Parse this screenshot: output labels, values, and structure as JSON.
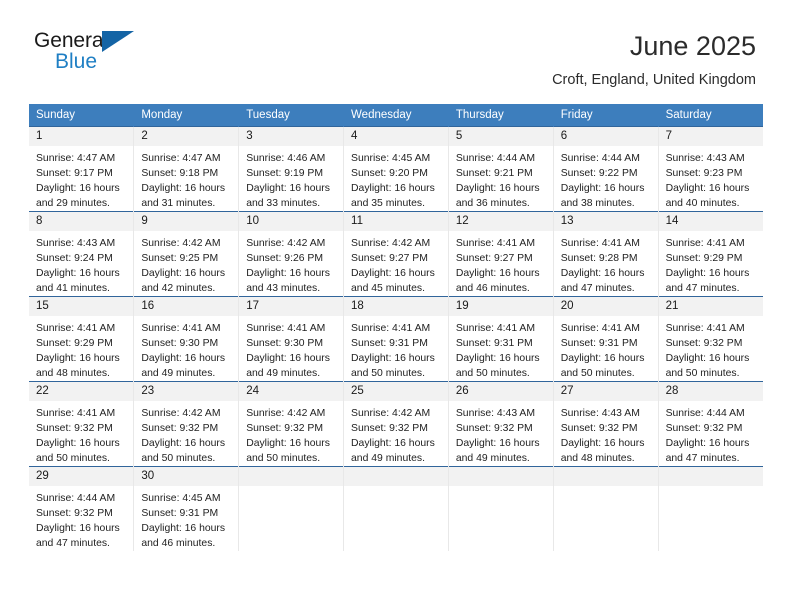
{
  "brand": {
    "name_top": "General",
    "name_bottom": "Blue",
    "accent_color": "#1464a5",
    "text_color": "#1f7fc4"
  },
  "header": {
    "title": "June 2025",
    "subtitle": "Croft, England, United Kingdom"
  },
  "theme": {
    "header_row_bg": "#3d7ebd",
    "week_divider": "#31659b",
    "daynum_band_bg": "#f2f2f2"
  },
  "weekdays": [
    "Sunday",
    "Monday",
    "Tuesday",
    "Wednesday",
    "Thursday",
    "Friday",
    "Saturday"
  ],
  "weeks": [
    [
      {
        "day": "1",
        "sunrise": "Sunrise: 4:47 AM",
        "sunset": "Sunset: 9:17 PM",
        "daylight_1": "Daylight: 16 hours",
        "daylight_2": "and 29 minutes."
      },
      {
        "day": "2",
        "sunrise": "Sunrise: 4:47 AM",
        "sunset": "Sunset: 9:18 PM",
        "daylight_1": "Daylight: 16 hours",
        "daylight_2": "and 31 minutes."
      },
      {
        "day": "3",
        "sunrise": "Sunrise: 4:46 AM",
        "sunset": "Sunset: 9:19 PM",
        "daylight_1": "Daylight: 16 hours",
        "daylight_2": "and 33 minutes."
      },
      {
        "day": "4",
        "sunrise": "Sunrise: 4:45 AM",
        "sunset": "Sunset: 9:20 PM",
        "daylight_1": "Daylight: 16 hours",
        "daylight_2": "and 35 minutes."
      },
      {
        "day": "5",
        "sunrise": "Sunrise: 4:44 AM",
        "sunset": "Sunset: 9:21 PM",
        "daylight_1": "Daylight: 16 hours",
        "daylight_2": "and 36 minutes."
      },
      {
        "day": "6",
        "sunrise": "Sunrise: 4:44 AM",
        "sunset": "Sunset: 9:22 PM",
        "daylight_1": "Daylight: 16 hours",
        "daylight_2": "and 38 minutes."
      },
      {
        "day": "7",
        "sunrise": "Sunrise: 4:43 AM",
        "sunset": "Sunset: 9:23 PM",
        "daylight_1": "Daylight: 16 hours",
        "daylight_2": "and 40 minutes."
      }
    ],
    [
      {
        "day": "8",
        "sunrise": "Sunrise: 4:43 AM",
        "sunset": "Sunset: 9:24 PM",
        "daylight_1": "Daylight: 16 hours",
        "daylight_2": "and 41 minutes."
      },
      {
        "day": "9",
        "sunrise": "Sunrise: 4:42 AM",
        "sunset": "Sunset: 9:25 PM",
        "daylight_1": "Daylight: 16 hours",
        "daylight_2": "and 42 minutes."
      },
      {
        "day": "10",
        "sunrise": "Sunrise: 4:42 AM",
        "sunset": "Sunset: 9:26 PM",
        "daylight_1": "Daylight: 16 hours",
        "daylight_2": "and 43 minutes."
      },
      {
        "day": "11",
        "sunrise": "Sunrise: 4:42 AM",
        "sunset": "Sunset: 9:27 PM",
        "daylight_1": "Daylight: 16 hours",
        "daylight_2": "and 45 minutes."
      },
      {
        "day": "12",
        "sunrise": "Sunrise: 4:41 AM",
        "sunset": "Sunset: 9:27 PM",
        "daylight_1": "Daylight: 16 hours",
        "daylight_2": "and 46 minutes."
      },
      {
        "day": "13",
        "sunrise": "Sunrise: 4:41 AM",
        "sunset": "Sunset: 9:28 PM",
        "daylight_1": "Daylight: 16 hours",
        "daylight_2": "and 47 minutes."
      },
      {
        "day": "14",
        "sunrise": "Sunrise: 4:41 AM",
        "sunset": "Sunset: 9:29 PM",
        "daylight_1": "Daylight: 16 hours",
        "daylight_2": "and 47 minutes."
      }
    ],
    [
      {
        "day": "15",
        "sunrise": "Sunrise: 4:41 AM",
        "sunset": "Sunset: 9:29 PM",
        "daylight_1": "Daylight: 16 hours",
        "daylight_2": "and 48 minutes."
      },
      {
        "day": "16",
        "sunrise": "Sunrise: 4:41 AM",
        "sunset": "Sunset: 9:30 PM",
        "daylight_1": "Daylight: 16 hours",
        "daylight_2": "and 49 minutes."
      },
      {
        "day": "17",
        "sunrise": "Sunrise: 4:41 AM",
        "sunset": "Sunset: 9:30 PM",
        "daylight_1": "Daylight: 16 hours",
        "daylight_2": "and 49 minutes."
      },
      {
        "day": "18",
        "sunrise": "Sunrise: 4:41 AM",
        "sunset": "Sunset: 9:31 PM",
        "daylight_1": "Daylight: 16 hours",
        "daylight_2": "and 50 minutes."
      },
      {
        "day": "19",
        "sunrise": "Sunrise: 4:41 AM",
        "sunset": "Sunset: 9:31 PM",
        "daylight_1": "Daylight: 16 hours",
        "daylight_2": "and 50 minutes."
      },
      {
        "day": "20",
        "sunrise": "Sunrise: 4:41 AM",
        "sunset": "Sunset: 9:31 PM",
        "daylight_1": "Daylight: 16 hours",
        "daylight_2": "and 50 minutes."
      },
      {
        "day": "21",
        "sunrise": "Sunrise: 4:41 AM",
        "sunset": "Sunset: 9:32 PM",
        "daylight_1": "Daylight: 16 hours",
        "daylight_2": "and 50 minutes."
      }
    ],
    [
      {
        "day": "22",
        "sunrise": "Sunrise: 4:41 AM",
        "sunset": "Sunset: 9:32 PM",
        "daylight_1": "Daylight: 16 hours",
        "daylight_2": "and 50 minutes."
      },
      {
        "day": "23",
        "sunrise": "Sunrise: 4:42 AM",
        "sunset": "Sunset: 9:32 PM",
        "daylight_1": "Daylight: 16 hours",
        "daylight_2": "and 50 minutes."
      },
      {
        "day": "24",
        "sunrise": "Sunrise: 4:42 AM",
        "sunset": "Sunset: 9:32 PM",
        "daylight_1": "Daylight: 16 hours",
        "daylight_2": "and 50 minutes."
      },
      {
        "day": "25",
        "sunrise": "Sunrise: 4:42 AM",
        "sunset": "Sunset: 9:32 PM",
        "daylight_1": "Daylight: 16 hours",
        "daylight_2": "and 49 minutes."
      },
      {
        "day": "26",
        "sunrise": "Sunrise: 4:43 AM",
        "sunset": "Sunset: 9:32 PM",
        "daylight_1": "Daylight: 16 hours",
        "daylight_2": "and 49 minutes."
      },
      {
        "day": "27",
        "sunrise": "Sunrise: 4:43 AM",
        "sunset": "Sunset: 9:32 PM",
        "daylight_1": "Daylight: 16 hours",
        "daylight_2": "and 48 minutes."
      },
      {
        "day": "28",
        "sunrise": "Sunrise: 4:44 AM",
        "sunset": "Sunset: 9:32 PM",
        "daylight_1": "Daylight: 16 hours",
        "daylight_2": "and 47 minutes."
      }
    ],
    [
      {
        "day": "29",
        "sunrise": "Sunrise: 4:44 AM",
        "sunset": "Sunset: 9:32 PM",
        "daylight_1": "Daylight: 16 hours",
        "daylight_2": "and 47 minutes."
      },
      {
        "day": "30",
        "sunrise": "Sunrise: 4:45 AM",
        "sunset": "Sunset: 9:31 PM",
        "daylight_1": "Daylight: 16 hours",
        "daylight_2": "and 46 minutes."
      },
      {
        "day": "",
        "sunrise": "",
        "sunset": "",
        "daylight_1": "",
        "daylight_2": ""
      },
      {
        "day": "",
        "sunrise": "",
        "sunset": "",
        "daylight_1": "",
        "daylight_2": ""
      },
      {
        "day": "",
        "sunrise": "",
        "sunset": "",
        "daylight_1": "",
        "daylight_2": ""
      },
      {
        "day": "",
        "sunrise": "",
        "sunset": "",
        "daylight_1": "",
        "daylight_2": ""
      },
      {
        "day": "",
        "sunrise": "",
        "sunset": "",
        "daylight_1": "",
        "daylight_2": ""
      }
    ]
  ]
}
